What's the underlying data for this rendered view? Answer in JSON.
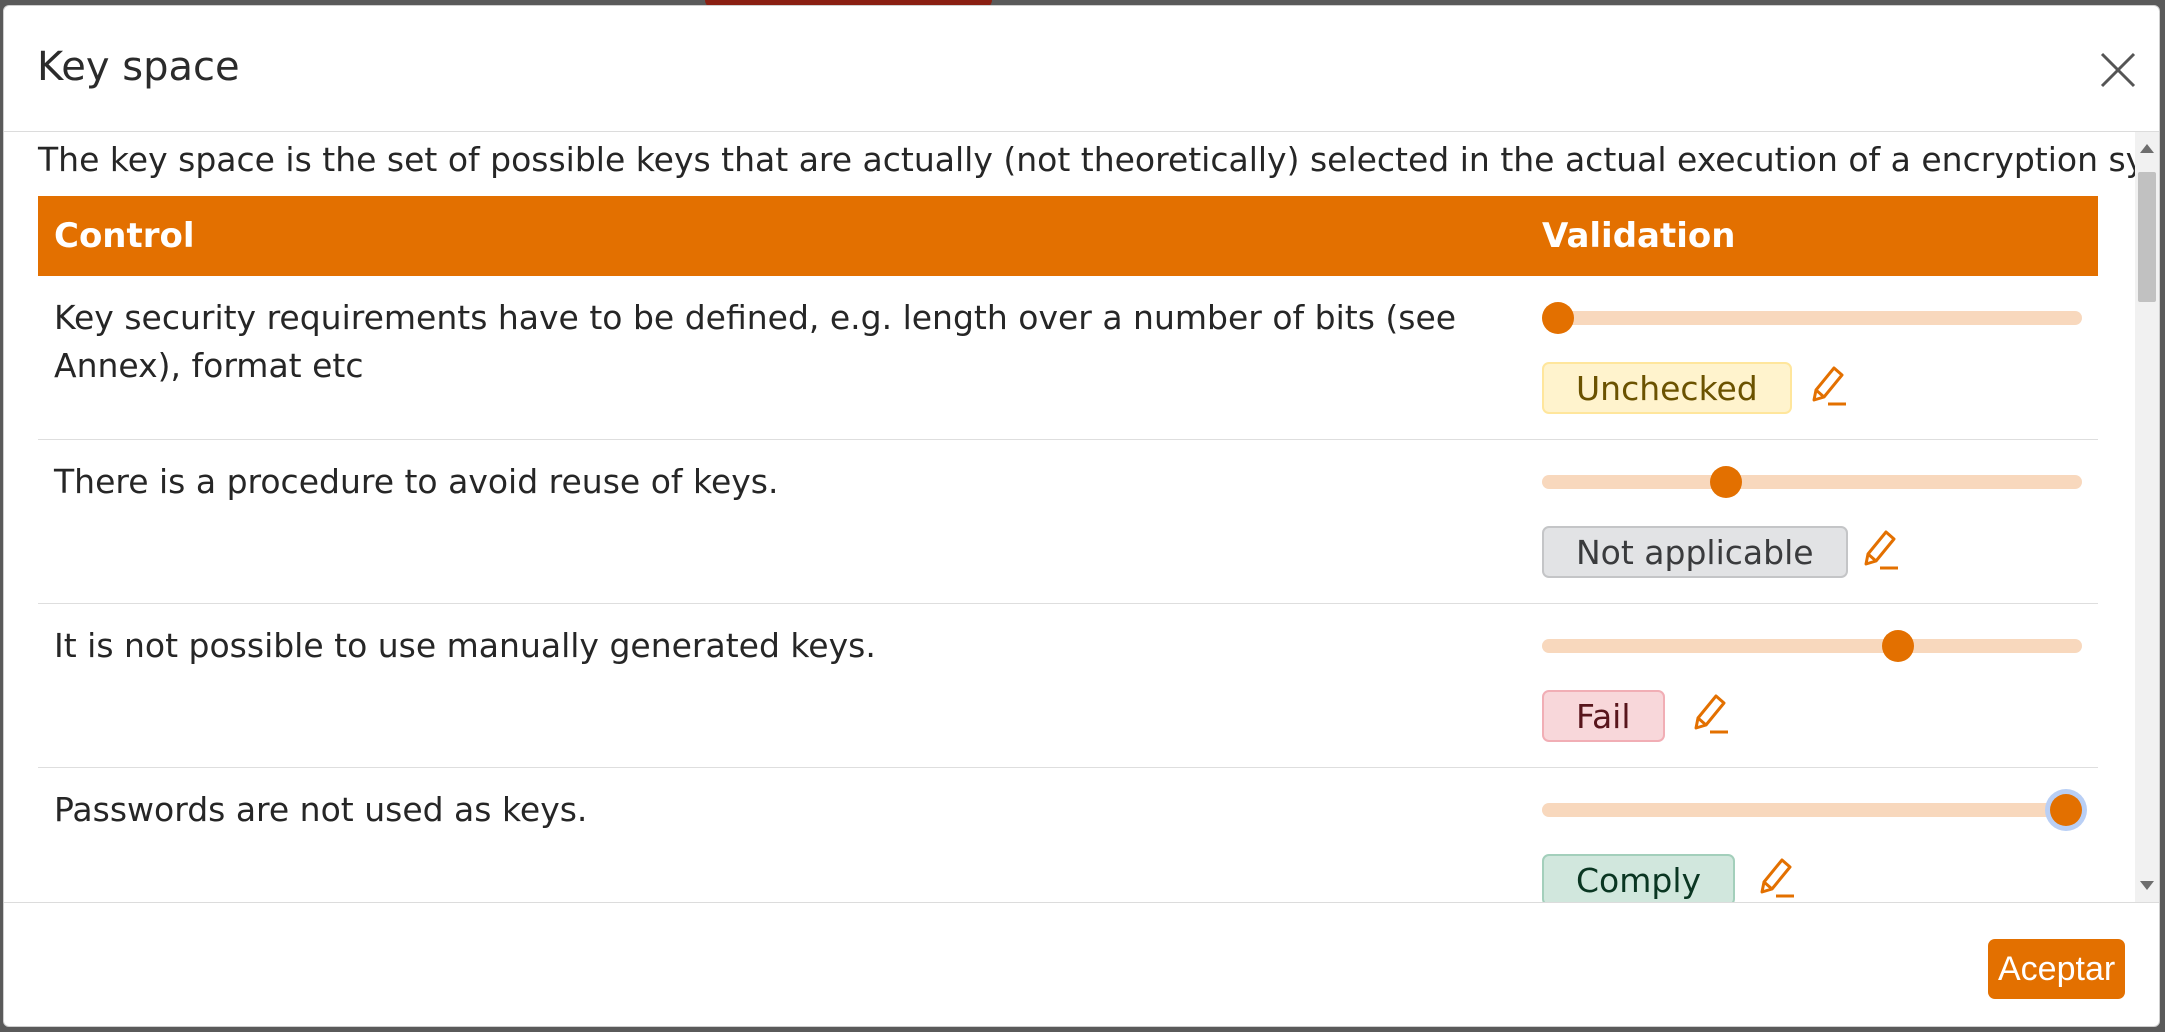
{
  "modal": {
    "title": "Key space",
    "description": "The key space is the set of possible keys that are actually (not theoretically) selected in the actual execution of a encryption system."
  },
  "table": {
    "headers": {
      "control": "Control",
      "validation": "Validation"
    },
    "rows": [
      {
        "control": "Key security requirements have to be defined, e.g. length over a number of bits (see Annex), format etc",
        "status": "Unchecked",
        "slider_level": 0
      },
      {
        "control": "There is a procedure to avoid reuse of keys.",
        "status": "Not applicable",
        "slider_level": 0.33
      },
      {
        "control": "It is not possible to use manually generated keys.",
        "status": "Fail",
        "slider_level": 0.67
      },
      {
        "control": "Passwords are not used as keys.",
        "status": "Comply",
        "slider_level": 1
      }
    ]
  },
  "footer": {
    "accept_label": "Aceptar"
  },
  "colors": {
    "accent": "#e37000",
    "slider_track": "#f8d8bd",
    "unchecked": "#fff3cd",
    "not_applicable": "#e2e3e5",
    "fail": "#f8d7da",
    "comply": "#d1e7dd"
  },
  "icons": {
    "close": "close-icon",
    "edit": "pencil-icon"
  }
}
